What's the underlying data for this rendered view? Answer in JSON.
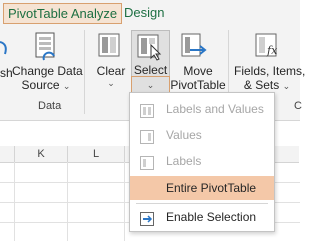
{
  "tabs": {
    "active": "PivotTable Analyze",
    "design": "Design"
  },
  "ribbon": {
    "refresh_partial": "sh",
    "change_data_source": [
      "Change Data",
      "Source"
    ],
    "data_group": "Data",
    "clear": "Clear",
    "select": "Select",
    "move_pivottable": [
      "Move",
      "PivotTable"
    ],
    "fields_items_sets": [
      "Fields, Items,",
      "& Sets"
    ],
    "right_group_partial": "C"
  },
  "grid": {
    "col_k": "K",
    "col_l": "L"
  },
  "menu": {
    "items": [
      {
        "label": "Labels and Values",
        "enabled": false,
        "underline": "a"
      },
      {
        "label": "Values",
        "enabled": false,
        "underline": "V"
      },
      {
        "label": "Labels",
        "enabled": false,
        "underline": "L"
      },
      {
        "label": "Entire PivotTable",
        "enabled": true,
        "highlighted": true,
        "underline": "T"
      },
      {
        "label": "Enable Selection",
        "enabled": true,
        "underline": "E"
      }
    ]
  },
  "colors": {
    "accent": "#1d6f42",
    "tab_highlight": "#f5e3d3",
    "menu_highlight": "#f4c8a8",
    "button_outline": "#d8a06f"
  }
}
